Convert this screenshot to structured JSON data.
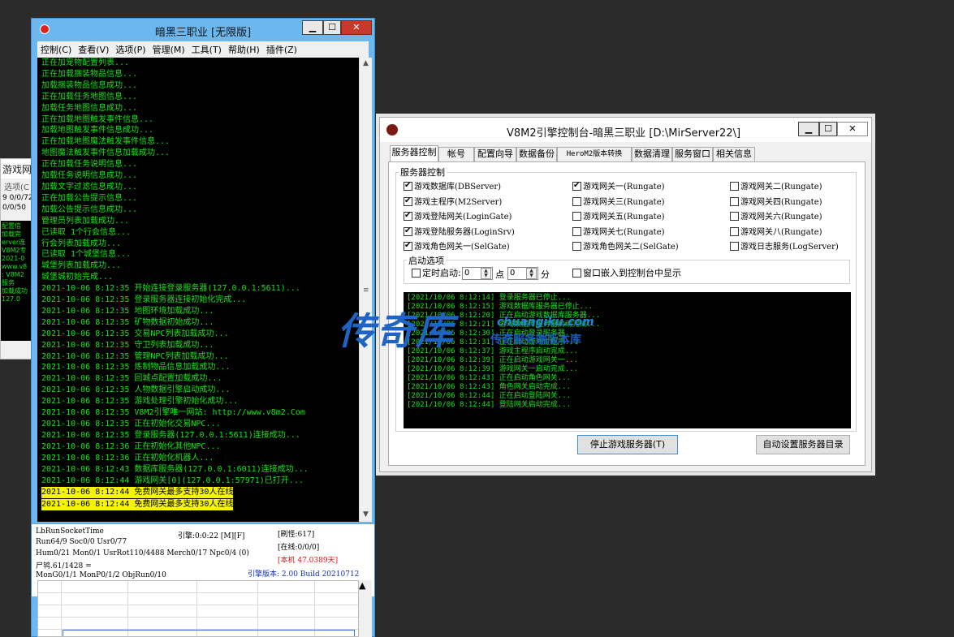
{
  "bg_window": {
    "title_fragment": "游戏网",
    "menu_fragment": "选项(C",
    "lines": [
      "9 0/0/72",
      "0/0/50"
    ],
    "log_fragments": [
      "配置信",
      "加载完",
      "erver连",
      "V8M2专",
      "2021-0",
      "www.v8",
      ": V8M2",
      "服务",
      "加载成功",
      "127.0"
    ]
  },
  "main_window": {
    "title": "暗黑三职业 [无限版]",
    "buttons": {
      "minimize": "▁",
      "maximize": "☐",
      "close": "✕"
    },
    "menu": [
      "控制(C)",
      "查看(V)",
      "选项(P)",
      "管理(M)",
      "工具(T)",
      "帮助(H)",
      "插件(Z)"
    ],
    "log_lines": [
      "正在加宠物配置列表...",
      "正在加载捆装物品信息...",
      "加载捆装物品信息成功...",
      "正在加载任务地图信息...",
      "加载任务地图信息成功...",
      "正在加载地图触发事件信息...",
      "加载地图触发事件信息成功...",
      "正在加载地图魔法触发事件信息...",
      "地图魔法触发事件信息加载成功...",
      "正在加载任务说明信息...",
      "加载任务说明信息成功...",
      "加载文字过滤信息成功...",
      "正在加载公告提示信息...",
      "加载公告提示信息成功...",
      "管理员列表加载成功...",
      "已读取 1个行会信息...",
      "行会列表加载成功...",
      "已读取 1个城堡信息...",
      "城堡列表加载成功...",
      "城堡城初始完成...",
      "2021-10-06 8:12:35 开始连接登录服务器(127.0.0.1:5611)...",
      "2021-10-06 8:12:35 登录服务器连接初始化完成...",
      "2021-10-06 8:12:35 地图环境加载成功...",
      "2021-10-06 8:12:35 矿物数据初始成功...",
      "2021-10-06 8:12:35 交易NPC列表加载成功...",
      "2021-10-06 8:12:35 守卫列表加载成功...",
      "2021-10-06 8:12:35 管理NPC列表加载成功...",
      "2021-10-06 8:12:35 炼制物品信息加载成功...",
      "2021-10-06 8:12:35 回城点配置加载成功...",
      "2021-10-06 8:12:35 人物数据引擎启动成功...",
      "2021-10-06 8:12:35 游戏处理引擎初始化成功...",
      "2021-10-06 8:12:35 V8M2引擎唯一网站: http://www.v8m2.Com",
      "2021-10-06 8:12:35 正在初始化交易NPC...",
      "2021-10-06 8:12:35 登录服务器(127.0.0.1:5611)连接成功...",
      "2021-10-06 8:12:36 正在初始化其他NPC...",
      "2021-10-06 8:12:36 正在初始化机器人...",
      "2021-10-06 8:12:43 数据库服务器(127.0.0.1:6011)连接成功...",
      "2021-10-06 8:12:44 游戏网关[0](127.0.0.1:57971)已打开..."
    ],
    "highlight_lines": [
      "2021-10-06 8:12:44 免费网关最多支持30人在线",
      "2021-10-06 8:12:44 免费网关最多支持30人在线"
    ],
    "status": {
      "l1": "LbRunSocketTime",
      "l2": "Run64/9 Soc0/0 Usr0/77",
      "l3": "Hum0/21 Mon0/1 UsrRot110/4488 Merch0/17 Npc0/4 (0)",
      "l4": "尸鸨.61/1428 =",
      "l5": "MonG0/1/1 MonP0/1/2 ObjRun0/10",
      "engine": "引擎:0:0:22 [M][F]",
      "refresh": "[刷怪:617]",
      "online": "[在线:0/0/0]",
      "local": "[本机 47.0389天]",
      "version": "引擎版本: 2.00 Build 20210712"
    }
  },
  "console_window": {
    "title": "V8M2引擎控制台-暗黑三职业 [D:\\MirServer22\\]",
    "buttons": {
      "minimize": "▁",
      "maximize": "☐",
      "close": "✕"
    },
    "tabs": [
      "服务器控制",
      "帐号",
      "配置向导",
      "数据备份",
      "HeroM2版本转换",
      "数据清理",
      "服务窗口",
      "相关信息"
    ],
    "group_title": "服务器控制",
    "checkboxes": [
      {
        "label": "游戏数据库(DBServer)",
        "checked": true
      },
      {
        "label": "游戏网关一(Rungate)",
        "checked": true
      },
      {
        "label": "游戏网关二(Rungate)",
        "checked": false
      },
      {
        "label": "游戏主程序(M2Server)",
        "checked": true
      },
      {
        "label": "游戏网关三(Rungate)",
        "checked": false
      },
      {
        "label": "游戏网关四(Rungate)",
        "checked": false
      },
      {
        "label": "游戏登陆网关(LoginGate)",
        "checked": true
      },
      {
        "label": "游戏网关五(Rungate)",
        "checked": false
      },
      {
        "label": "游戏网关六(Rungate)",
        "checked": false
      },
      {
        "label": "游戏登陆服务器(LoginSrv)",
        "checked": true
      },
      {
        "label": "游戏网关七(Rungate)",
        "checked": false
      },
      {
        "label": "游戏网关八(Rungate)",
        "checked": false
      },
      {
        "label": "游戏角色网关一(SelGate)",
        "checked": true
      },
      {
        "label": "游戏角色网关二(SelGate)",
        "checked": false
      },
      {
        "label": "游戏日志服务(LogServer)",
        "checked": false
      }
    ],
    "startup": {
      "group_title": "启动选项",
      "timed_label": "定时启动:",
      "timed_checked": false,
      "hour": "0",
      "hour_unit": "点",
      "minute": "0",
      "minute_unit": "分",
      "embed_label": "窗口嵌入到控制台中显示",
      "embed_checked": false
    },
    "log_lines": [
      "[2021/10/06 8:12:14] 登录服务器已停止...",
      "[2021/10/06 8:12:15] 游戏数据库服务器已停止...",
      "[2021/10/06 8:12:20] 正在启动游戏数据库服务器...",
      "[2021/10/06 8:12:21] 游戏数据库服务器启动完成...",
      "[2021/10/06 8:12:30] 正在启动登录服务器...",
      "[2021/10/06 8:12:31] 正在启动游戏主程序...",
      "[2021/10/06 8:12:37] 游戏主程序启动完成...",
      "[2021/10/06 8:12:39] 正在启动游戏网关一...",
      "[2021/10/06 8:12:39] 游戏网关一启动完成...",
      "[2021/10/06 8:12:43] 正在启动角色网关...",
      "[2021/10/06 8:12:43] 角色网关启动完成...",
      "[2021/10/06 8:12:44] 正在启动登陆网关...",
      "[2021/10/06 8:12:44] 登陆网关启动完成..."
    ],
    "stop_button": "停止游戏服务器(T)",
    "auto_button": "自动设置服务器目录"
  },
  "watermark": {
    "big": "传奇库",
    "en": "chuangiku.com",
    "sub": "传奇服务端版本库"
  }
}
